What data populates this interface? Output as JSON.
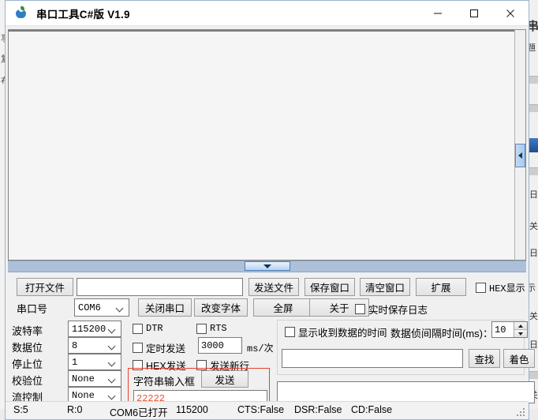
{
  "window": {
    "title": "串口工具C#版  V1.9",
    "icon": "apple-icon",
    "minimize_label": "—",
    "maximize_label": "□",
    "close_label": "✕"
  },
  "receive_area": {
    "text": "",
    "scrollbar": "vertical-scrollbar",
    "splitter": "horizontal-splitter"
  },
  "toolbar_row1": {
    "open_file": "打开文件",
    "file_path_value": "",
    "send_file": "发送文件",
    "save_window": "保存窗口",
    "clear_window": "清空窗口",
    "expand": "扩展",
    "hex_display": "HEX显示",
    "hex_display_checked": false
  },
  "toolbar_row2": {
    "port_label": "串口号",
    "port_value": "COM6",
    "close_port": "关闭串口",
    "change_font": "改变字体",
    "fullscreen": "全屏",
    "about": "关于",
    "realtime_log": "实时保存日志",
    "realtime_log_checked": false
  },
  "settings": {
    "baud_label": "波特率",
    "baud_value": "115200",
    "data_label": "数据位",
    "data_value": "8",
    "stop_label": "停止位",
    "stop_value": "1",
    "parity_label": "校验位",
    "parity_value": "None",
    "flow_label": "流控制",
    "flow_value": "None"
  },
  "send_options": {
    "dtr": "DTR",
    "dtr_checked": false,
    "rts": "RTS",
    "rts_checked": false,
    "timed_send": "定时发送",
    "timed_send_checked": false,
    "interval_value": "3000",
    "interval_unit": "ms/次",
    "hex_send": "HEX发送",
    "hex_send_checked": false,
    "send_newline": "发送新行",
    "send_newline_checked": false
  },
  "send_group": {
    "input_label": "字符串输入框",
    "send_button": "发送",
    "send_value": "22222",
    "highlight_color": "#e8402a",
    "value_color": "#e2552e"
  },
  "recv_options": {
    "show_time": "显示收到数据的时间",
    "show_time_checked": false,
    "interval_label": "数据侦间隔时间(ms)：",
    "interval_value": "10"
  },
  "find_bar": {
    "find_value": "",
    "find_button": "查找",
    "color_button": "着色"
  },
  "send_input": {
    "value": ""
  },
  "statusbar": {
    "sent": "S:5",
    "received": "R:0",
    "port_state": "COM6已打开",
    "baud": "115200",
    "cts": "CTS:False",
    "dsr": "DSR:False",
    "cd": "CD:False"
  },
  "background": {
    "left_chars": [
      "享",
      "复",
      "布"
    ],
    "right_items": [
      "串",
      "題",
      "[日",
      "[关",
      "[日",
      "[关",
      "[日",
      "[关",
      "示"
    ],
    "bottom_items": [
      "115200",
      "DTR",
      "RTS"
    ],
    "bottom_label": "波特率"
  }
}
